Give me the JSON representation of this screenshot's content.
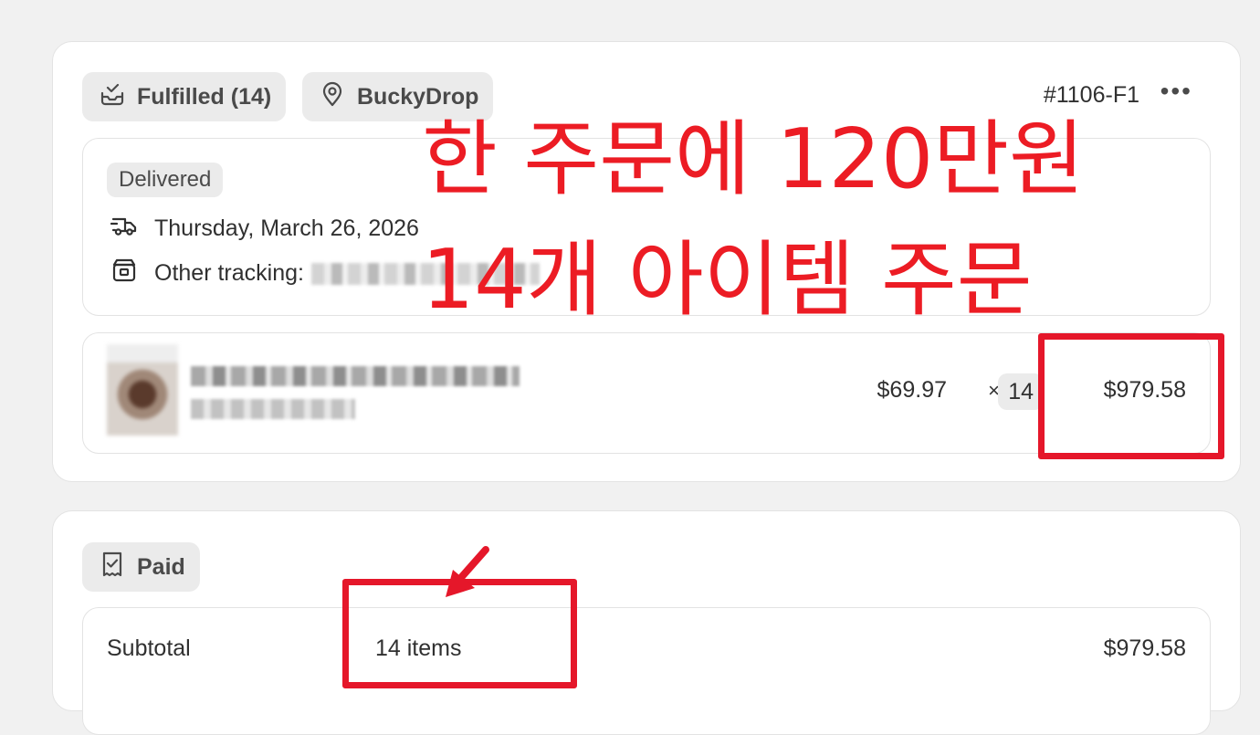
{
  "fulfillment": {
    "status_label": "Fulfilled (14)",
    "location_label": "BuckyDrop",
    "order_number": "#1106-F1",
    "more_label": "•••",
    "delivery": {
      "badge": "Delivered",
      "date": "Thursday, March 26, 2026",
      "tracking_label": "Other tracking:"
    },
    "line_item": {
      "unit_price": "$69.97",
      "times": "×",
      "quantity": "14",
      "total": "$979.58"
    }
  },
  "payment": {
    "status_label": "Paid",
    "subtotal_label": "Subtotal",
    "subtotal_items": "14 items",
    "subtotal_value": "$979.58"
  },
  "annotation": {
    "line1": "한 주문에 120만원",
    "line2": "14개 아이템 주문",
    "color": "#ec1c24"
  },
  "icons": {
    "fulfilled": "inbox-check-icon",
    "location": "location-pin-icon",
    "delivery": "delivery-truck-icon",
    "tracking": "package-icon",
    "paid": "receipt-check-icon"
  }
}
